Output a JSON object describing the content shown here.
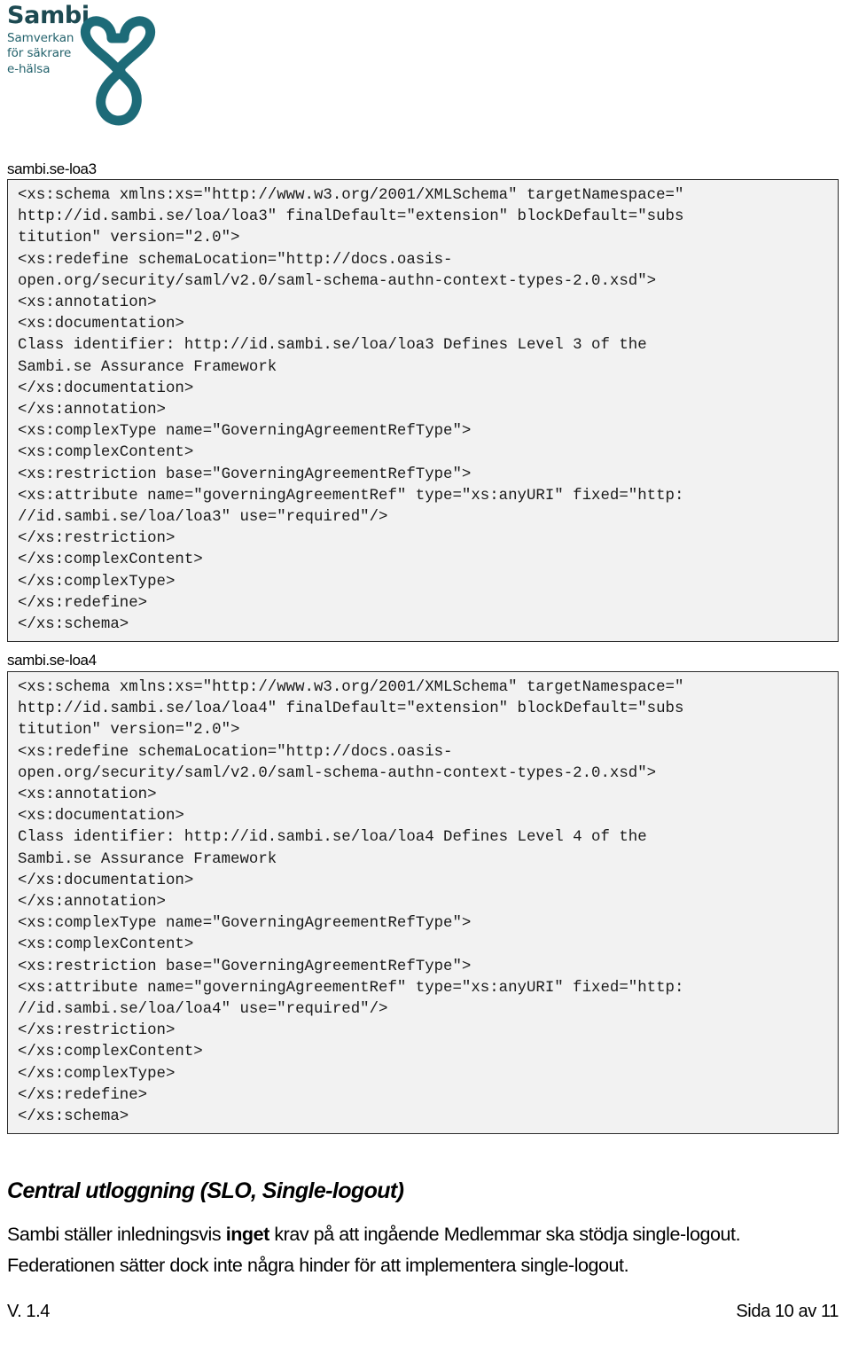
{
  "header": {
    "logo": {
      "wordmark": "Sambi",
      "tagline_line1": "Samverkan",
      "tagline_line2": "för säkrare",
      "tagline_line3": "e-hälsa",
      "mark_name": "heart-infinity-knot-icon",
      "color": "#1d6b78"
    }
  },
  "blocks": [
    {
      "caption": "sambi.se-loa3",
      "code": "<xs:schema xmlns:xs=\"http://www.w3.org/2001/XMLSchema\" targetNamespace=\"\nhttp://id.sambi.se/loa/loa3\" finalDefault=\"extension\" blockDefault=\"subs\ntitution\" version=\"2.0\">\n<xs:redefine schemaLocation=\"http://docs.oasis-\nopen.org/security/saml/v2.0/saml-schema-authn-context-types-2.0.xsd\">\n<xs:annotation>\n<xs:documentation>\nClass identifier: http://id.sambi.se/loa/loa3 Defines Level 3 of the\nSambi.se Assurance Framework\n</xs:documentation>\n</xs:annotation>\n<xs:complexType name=\"GoverningAgreementRefType\">\n<xs:complexContent>\n<xs:restriction base=\"GoverningAgreementRefType\">\n<xs:attribute name=\"governingAgreementRef\" type=\"xs:anyURI\" fixed=\"http:\n//id.sambi.se/loa/loa3\" use=\"required\"/>\n</xs:restriction>\n</xs:complexContent>\n</xs:complexType>\n</xs:redefine>\n</xs:schema>"
    },
    {
      "caption": "sambi.se-loa4",
      "code": "<xs:schema xmlns:xs=\"http://www.w3.org/2001/XMLSchema\" targetNamespace=\"\nhttp://id.sambi.se/loa/loa4\" finalDefault=\"extension\" blockDefault=\"subs\ntitution\" version=\"2.0\">\n<xs:redefine schemaLocation=\"http://docs.oasis-\nopen.org/security/saml/v2.0/saml-schema-authn-context-types-2.0.xsd\">\n<xs:annotation>\n<xs:documentation>\nClass identifier: http://id.sambi.se/loa/loa4 Defines Level 4 of the\nSambi.se Assurance Framework\n</xs:documentation>\n</xs:annotation>\n<xs:complexType name=\"GoverningAgreementRefType\">\n<xs:complexContent>\n<xs:restriction base=\"GoverningAgreementRefType\">\n<xs:attribute name=\"governingAgreementRef\" type=\"xs:anyURI\" fixed=\"http:\n//id.sambi.se/loa/loa4\" use=\"required\"/>\n</xs:restriction>\n</xs:complexContent>\n</xs:complexType>\n</xs:redefine>\n</xs:schema>"
    }
  ],
  "section": {
    "heading": "Central utloggning (SLO, Single-logout)",
    "paragraph": {
      "part1": "Sambi ställer inledningsvis ",
      "emphasis": "inget",
      "part2": " krav på att ingående Medlemmar ska stödja single-logout. Federationen sätter dock inte några hinder för att implementera single-logout."
    }
  },
  "footer": {
    "version": "V. 1.4",
    "page": "Sida 10 av 11"
  }
}
